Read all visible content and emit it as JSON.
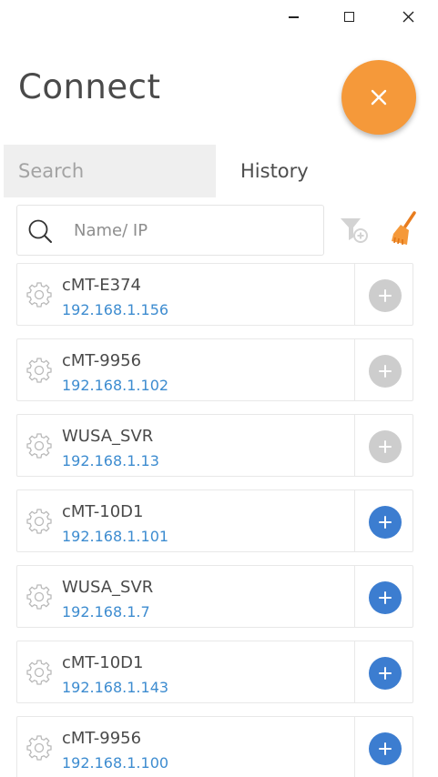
{
  "window_controls": {
    "minimize_icon": "minimize-icon",
    "maximize_icon": "maximize-icon",
    "close_icon": "close-icon"
  },
  "header": {
    "title": "Connect",
    "close_fab_icon": "close-icon",
    "fab_color": "#f5993a"
  },
  "tabs": [
    {
      "label": "Search",
      "active": false
    },
    {
      "label": "History",
      "active": true
    }
  ],
  "search": {
    "placeholder": "Name/ IP",
    "value": ""
  },
  "toolbar": {
    "filter_icon": "filter-add-icon",
    "clear_icon": "broom-icon"
  },
  "colors": {
    "accent_orange": "#f5993a",
    "ip_blue": "#3d8cd0",
    "add_enabled": "#3c7dd0",
    "add_disabled": "#cdcdcd"
  },
  "history": [
    {
      "name": "cMT-E374",
      "ip": "192.168.1.156",
      "can_add": false
    },
    {
      "name": "cMT-9956",
      "ip": "192.168.1.102",
      "can_add": false
    },
    {
      "name": "WUSA_SVR",
      "ip": "192.168.1.13",
      "can_add": false
    },
    {
      "name": "cMT-10D1",
      "ip": "192.168.1.101",
      "can_add": true
    },
    {
      "name": "WUSA_SVR",
      "ip": "192.168.1.7",
      "can_add": true
    },
    {
      "name": "cMT-10D1",
      "ip": "192.168.1.143",
      "can_add": true
    },
    {
      "name": "cMT-9956",
      "ip": "192.168.1.100",
      "can_add": true
    }
  ]
}
